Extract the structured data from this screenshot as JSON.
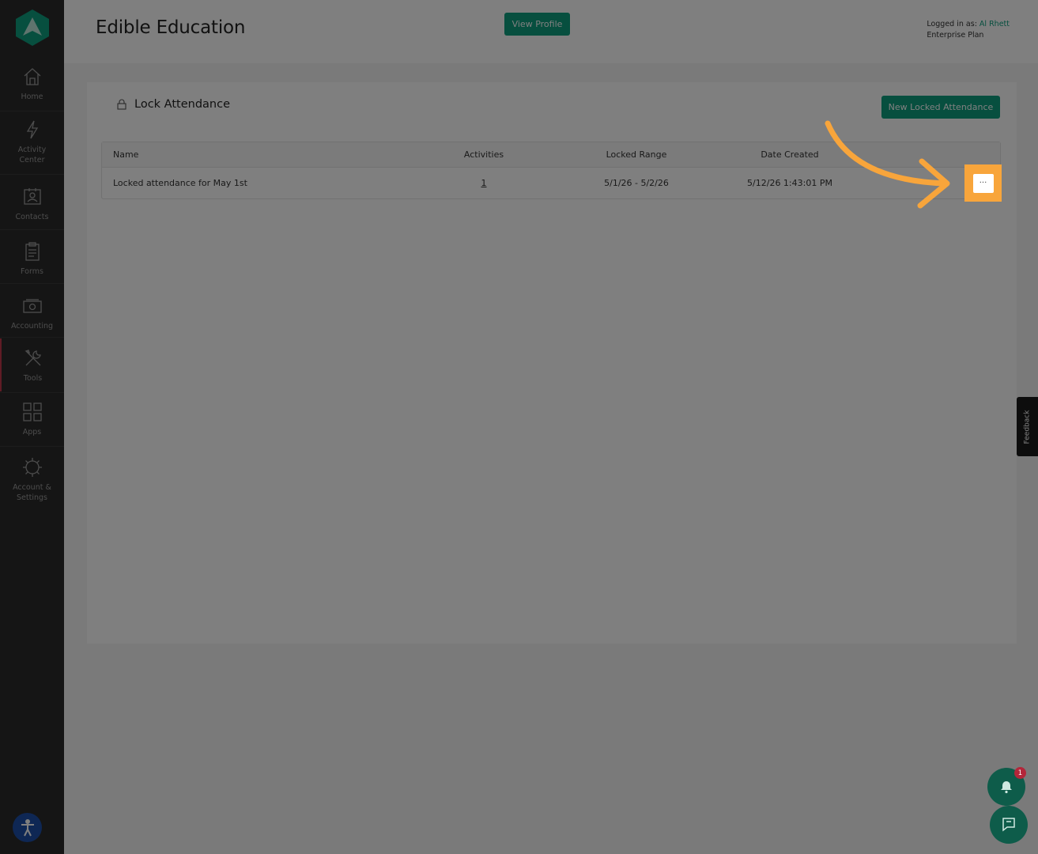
{
  "app": {
    "org_name": "Edible Education",
    "view_profile_label": "View Profile",
    "logged_in_label": "Logged in as:",
    "user_name": "Al Rhett",
    "plan": "Enterprise Plan"
  },
  "sidebar": {
    "items": [
      {
        "label": "Home",
        "icon": "home-icon"
      },
      {
        "label": "Activity Center",
        "icon": "bolt-icon"
      },
      {
        "label": "Contacts",
        "icon": "contacts-icon"
      },
      {
        "label": "Forms",
        "icon": "clipboard-icon"
      },
      {
        "label": "Accounting",
        "icon": "money-icon"
      },
      {
        "label": "Tools",
        "icon": "tools-icon",
        "active": true
      },
      {
        "label": "Apps",
        "icon": "apps-grid-icon"
      },
      {
        "label": "Account & Settings",
        "icon": "gear-icon"
      }
    ]
  },
  "page": {
    "title": "Lock Attendance",
    "new_button_label": "New Locked Attendance",
    "table": {
      "headers": [
        "Name",
        "Activities",
        "Locked Range",
        "Date Created"
      ],
      "rows": [
        {
          "name": "Locked attendance for May 1st",
          "activities": "1",
          "range": "5/1/26 - 5/2/26",
          "created": "5/12/26 1:43:01 PM",
          "more": "···"
        }
      ]
    }
  },
  "feedback_label": "Feedback",
  "notifications_count": "1",
  "colors": {
    "accent": "#0f9e7f",
    "highlight": "#f8a53b",
    "active_marker": "#c0384b",
    "sidebar_bg": "#2b2b2b"
  }
}
